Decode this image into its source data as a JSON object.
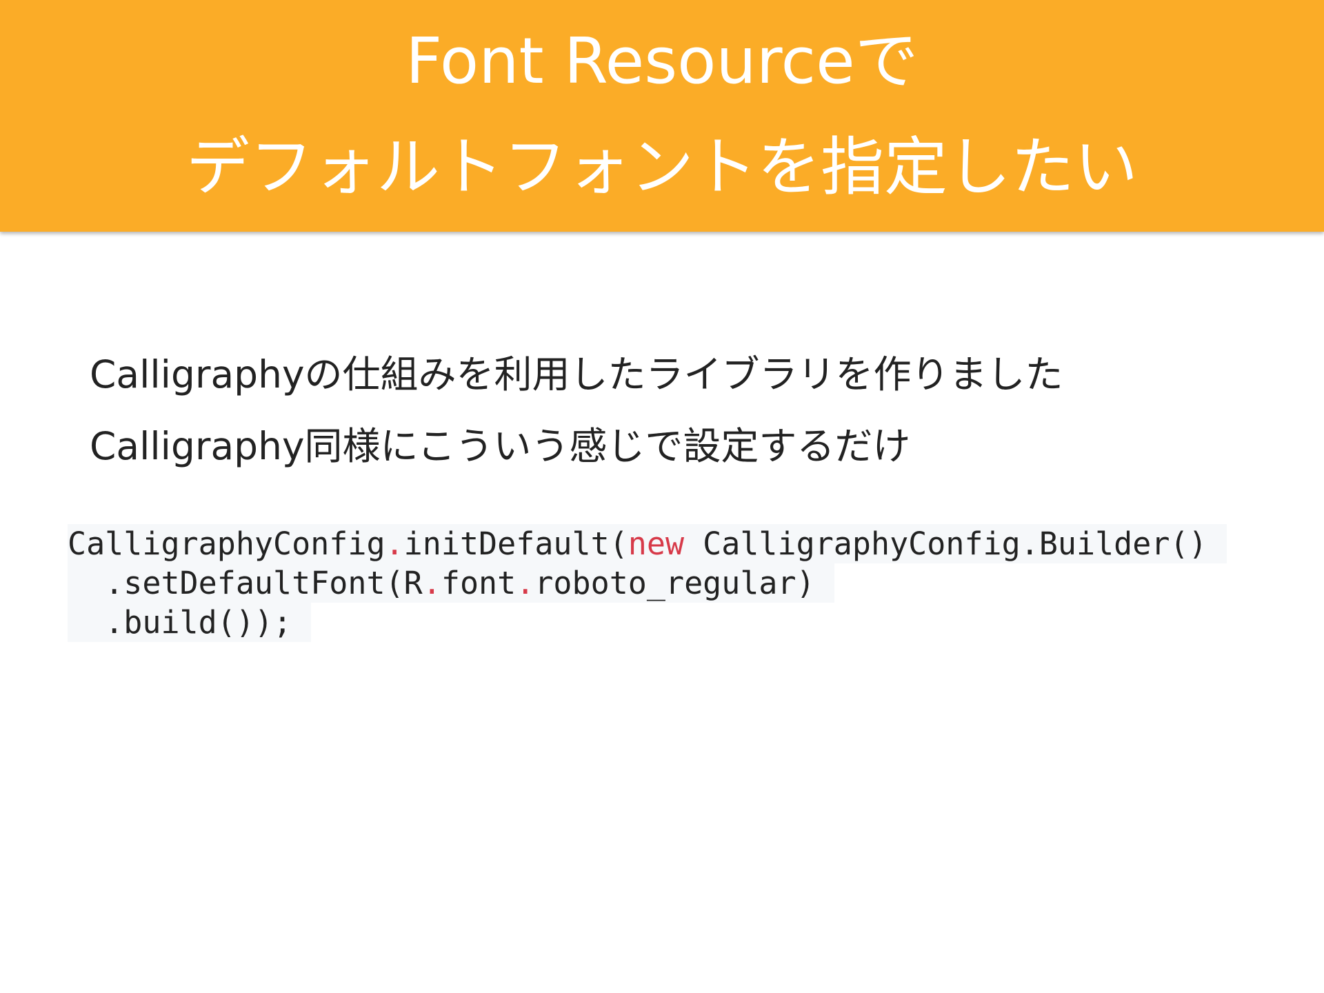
{
  "slide": {
    "title_line_1": "Font Resourceで",
    "title_line_2": "デフォルトフォントを指定したい",
    "body_line_1": "Calligraphyの仕組みを利用したライブラリを作りました",
    "body_line_2": "Calligraphy同様にこういう感じで設定するだけ",
    "code": {
      "line_1": {
        "part_a": "CalligraphyConfig",
        "dot_a": ".",
        "part_b": "initDefault(",
        "keyword": "new",
        "part_c": " CalligraphyConfig.Builder()"
      },
      "line_2": {
        "part_a": "  .setDefaultFont(R",
        "dot_a": ".",
        "part_b": "font",
        "dot_b": ".",
        "part_c": "roboto_regular)"
      },
      "line_3": {
        "part_a": "  .build());"
      }
    }
  },
  "colors": {
    "header_background": "#FBAC27",
    "title_text": "#FFFFFF",
    "code_keyword": "#D73A49",
    "code_background": "#F6F8FA"
  }
}
